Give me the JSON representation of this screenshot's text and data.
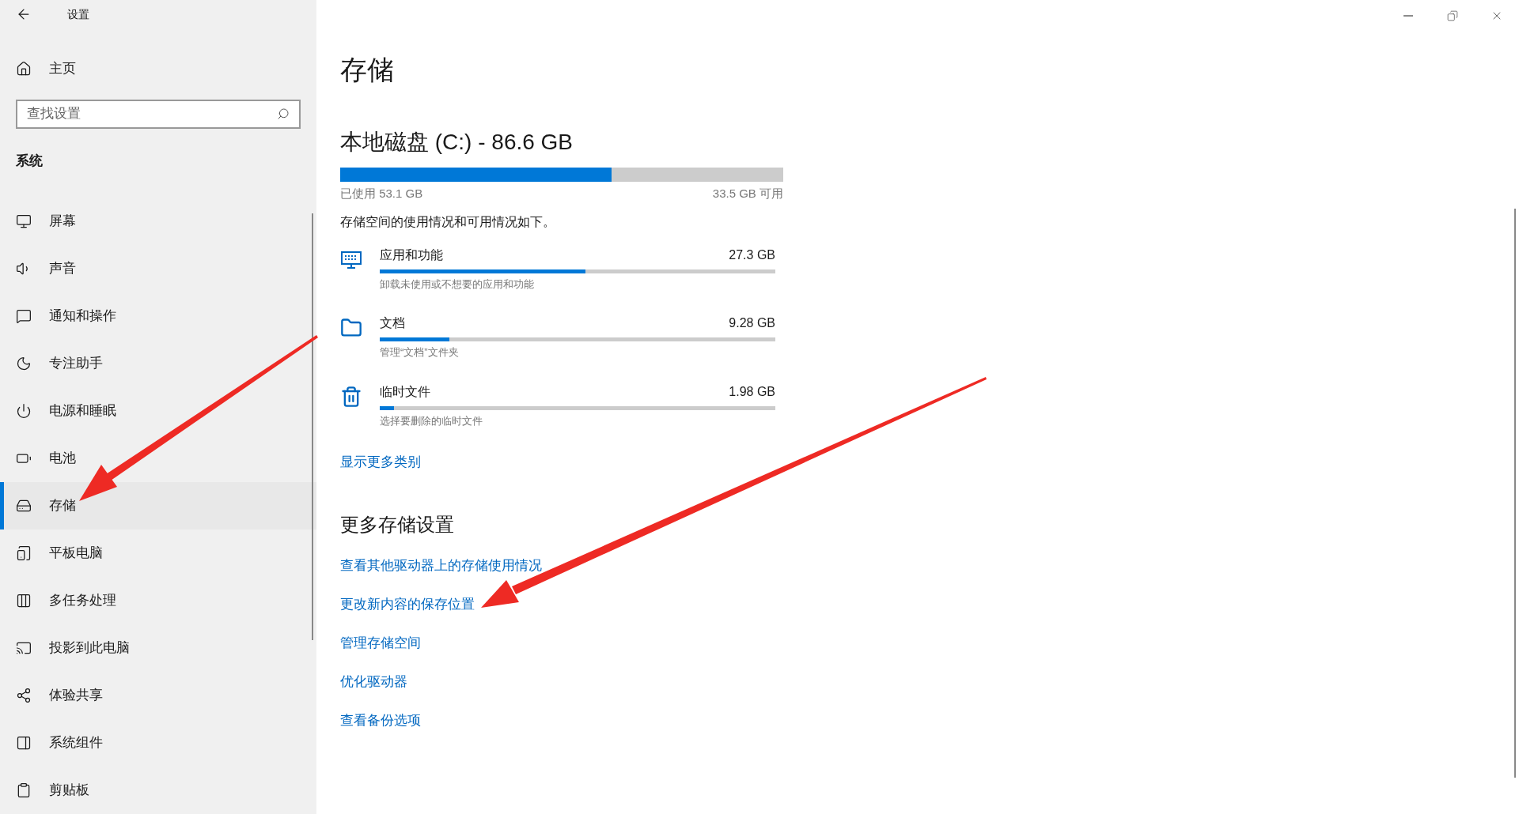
{
  "window": {
    "title": "设置"
  },
  "sidebar": {
    "home": "主页",
    "search": {
      "placeholder": "查找设置"
    },
    "section": "系统",
    "items": [
      {
        "label": "屏幕",
        "selected": false
      },
      {
        "label": "声音",
        "selected": false
      },
      {
        "label": "通知和操作",
        "selected": false
      },
      {
        "label": "专注助手",
        "selected": false
      },
      {
        "label": "电源和睡眠",
        "selected": false
      },
      {
        "label": "电池",
        "selected": false
      },
      {
        "label": "存储",
        "selected": true
      },
      {
        "label": "平板电脑",
        "selected": false
      },
      {
        "label": "多任务处理",
        "selected": false
      },
      {
        "label": "投影到此电脑",
        "selected": false
      },
      {
        "label": "体验共享",
        "selected": false
      },
      {
        "label": "系统组件",
        "selected": false
      },
      {
        "label": "剪贴板",
        "selected": false
      }
    ]
  },
  "page": {
    "title": "存储",
    "disk": {
      "title": "本地磁盘 (C:) - 86.6 GB",
      "level": 0.613,
      "used": "已使用 53.1 GB",
      "free": "33.5 GB 可用"
    },
    "description": "存储空间的使用情况和可用情况如下。",
    "categories": [
      {
        "name": "应用和功能",
        "size": "27.3 GB",
        "level": 0.52,
        "hint": "卸载未使用或不想要的应用和功能"
      },
      {
        "name": "文档",
        "size": "9.28 GB",
        "level": 0.175,
        "hint": "管理“文档”文件夹"
      },
      {
        "name": "临时文件",
        "size": "1.98 GB",
        "level": 0.037,
        "hint": "选择要删除的临时文件"
      }
    ],
    "show_more": "显示更多类别",
    "more_title": "更多存储设置",
    "links": [
      "查看其他驱动器上的存储使用情况",
      "更改新内容的保存位置",
      "管理存储空间",
      "优化驱动器",
      "查看备份选项"
    ]
  }
}
